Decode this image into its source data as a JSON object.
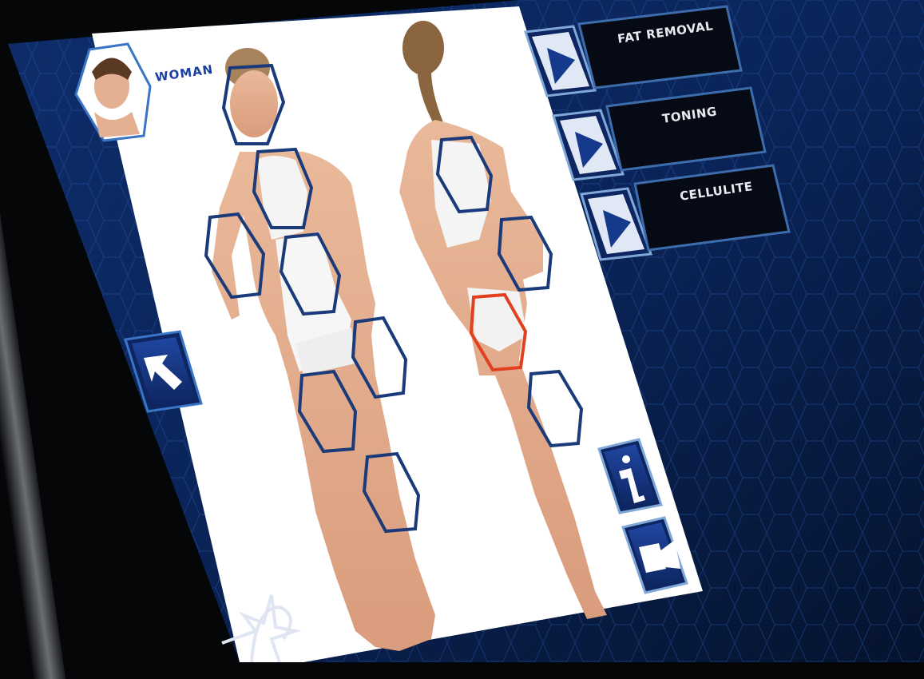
{
  "profile": {
    "label": "WOMAN",
    "avatar_icon": "woman-portrait-icon"
  },
  "menu": {
    "items": [
      {
        "label": "FAT REMOVAL",
        "icon": "play-triangle-icon"
      },
      {
        "label": "TONING",
        "icon": "play-triangle-icon"
      },
      {
        "label": "CELLULITE",
        "icon": "play-triangle-icon"
      }
    ]
  },
  "controls": {
    "back_icon": "arrow-up-left-icon",
    "info_icon": "info-icon",
    "video_icon": "video-camera-icon",
    "logo_icon": "star-p-logo-icon"
  },
  "body_zones": {
    "front": [
      "face",
      "chest",
      "right-arm",
      "abdomen",
      "left-hip",
      "right-thigh",
      "left-knee"
    ],
    "back": [
      "upper-back",
      "left-hand",
      "buttocks",
      "back-thigh"
    ],
    "selected": "buttocks"
  },
  "colors": {
    "zone_outline": "#1b3a7a",
    "zone_selected": "#e2401f",
    "panel_bg": "#0b1f4a",
    "button_bg": "#13307a"
  }
}
